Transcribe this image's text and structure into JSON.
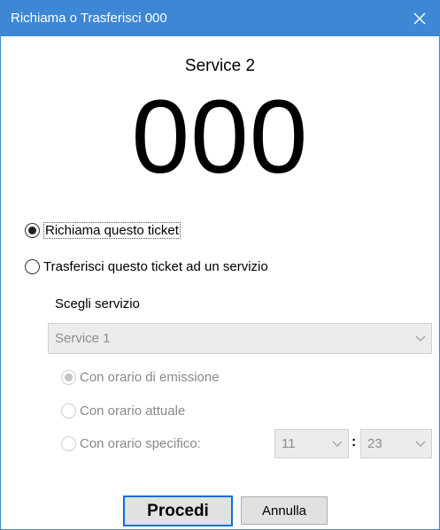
{
  "window": {
    "title": "Richiama o Trasferisci 000"
  },
  "ticket": {
    "service": "Service 2",
    "number": "000"
  },
  "options": {
    "recall_label": "Richiama questo ticket",
    "transfer_label": "Trasferisci questo ticket ad un servizio"
  },
  "transfer": {
    "choose_service_label": "Scegli servizio",
    "service_select_value": "Service 1",
    "time_options": [
      {
        "label": "Con orario di emissione",
        "selected": true
      },
      {
        "label": "Con orario attuale",
        "selected": false
      },
      {
        "label": "Con orario specifico:",
        "selected": false
      }
    ],
    "hour_value": "11",
    "minute_value": "23",
    "separator": ":"
  },
  "buttons": {
    "proceed": "Procedi",
    "cancel": "Annulla"
  },
  "colors": {
    "titlebar": "#3d87d4",
    "default_button_border": "#0f6fd6"
  }
}
